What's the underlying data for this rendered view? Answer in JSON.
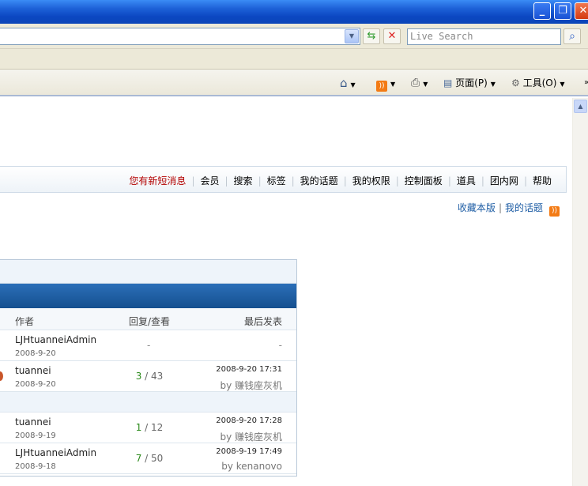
{
  "browser": {
    "search_placeholder": "Live Search",
    "window_buttons": [
      "minimize",
      "restore",
      "close"
    ],
    "command_bar": {
      "page_label": "页面(P)",
      "tools_label": "工具(O)"
    }
  },
  "forum": {
    "nav": [
      {
        "label": "您有新短消息",
        "alert": true
      },
      {
        "label": "会员"
      },
      {
        "label": "搜索"
      },
      {
        "label": "标签"
      },
      {
        "label": "我的话题"
      },
      {
        "label": "我的权限"
      },
      {
        "label": "控制面板"
      },
      {
        "label": "道具"
      },
      {
        "label": "团内网"
      },
      {
        "label": "帮助"
      }
    ],
    "subnav": {
      "bookmark": "收藏本版",
      "separator": "|",
      "my_topics": "我的话题"
    },
    "table": {
      "columns": {
        "author": "作者",
        "replies": "回复/查看",
        "last_post": "最后发表"
      },
      "rows": [
        {
          "author": "LJHtuanneiAdmin",
          "date": "2008-9-20",
          "replies": "-",
          "views": "",
          "last_time": "",
          "last_by": "-",
          "section_after": false
        },
        {
          "author": "tuannei",
          "date": "2008-9-20",
          "replies": "3",
          "views": "43",
          "last_time": "2008-9-20 17:31",
          "last_by": "by 赚钱座灰机",
          "section_after": true
        },
        {
          "author": "tuannei",
          "date": "2008-9-19",
          "replies": "1",
          "views": "12",
          "last_time": "2008-9-20 17:28",
          "last_by": "by 赚钱座灰机",
          "section_after": false
        },
        {
          "author": "LJHtuanneiAdmin",
          "date": "2008-9-18",
          "replies": "7",
          "views": "50",
          "last_time": "2008-9-19 17:49",
          "last_by": "by kenanovo",
          "section_after": false
        }
      ]
    }
  }
}
